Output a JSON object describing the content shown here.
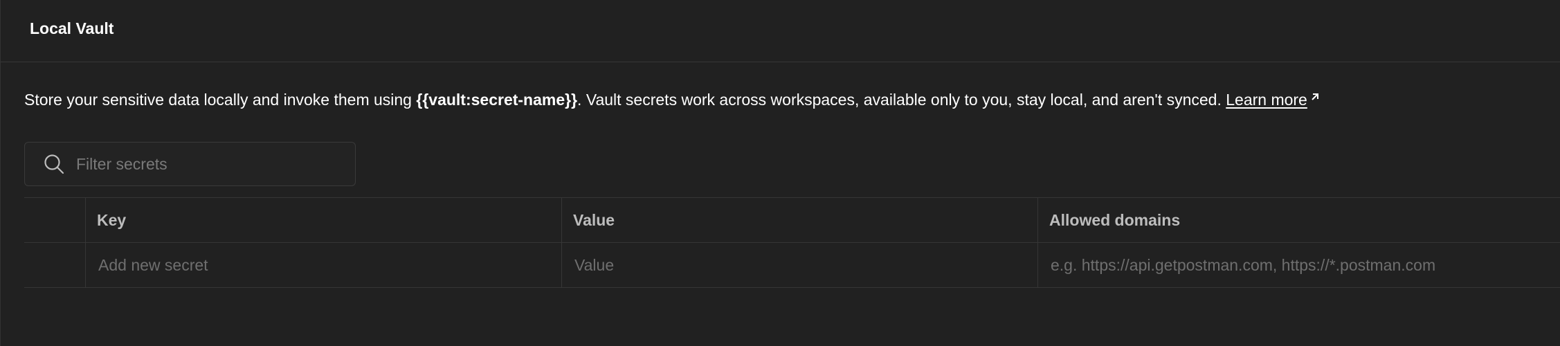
{
  "header": {
    "title": "Local Vault"
  },
  "description": {
    "prefix": "Store your sensitive data locally and invoke them using ",
    "token": "{{vault:secret-name}}",
    "suffix": ". Vault secrets work across workspaces, available only to you, stay local, and aren't synced. ",
    "link": "Learn more",
    "link_icon": "external-arrow-icon"
  },
  "search": {
    "placeholder": "Filter secrets",
    "icon": "search-icon"
  },
  "table": {
    "columns": [
      "Key",
      "Value",
      "Allowed domains"
    ],
    "new_row": {
      "key_placeholder": "Add new secret",
      "value_placeholder": "Value",
      "domains_placeholder": "e.g. https://api.getpostman.com, https://*.postman.com"
    }
  },
  "colors": {
    "background": "#212121",
    "border": "#363636",
    "text": "#ffffff",
    "muted": "#7a7a7a"
  }
}
